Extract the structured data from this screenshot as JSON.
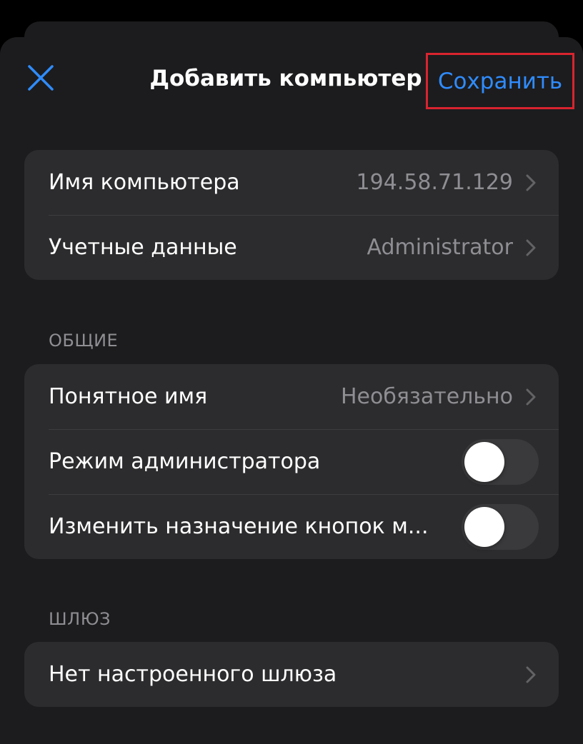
{
  "header": {
    "title": "Добавить компьютер",
    "save_label": "Сохранить",
    "close_icon": "close-icon"
  },
  "connection": {
    "rows": [
      {
        "label": "Имя компьютера",
        "value": "194.58.71.129"
      },
      {
        "label": "Учетные данные",
        "value": "Administrator"
      }
    ]
  },
  "general": {
    "header": "ОБЩИЕ",
    "friendly_name": {
      "label": "Понятное имя",
      "value": "Необязательно"
    },
    "admin_mode": {
      "label": "Режим администратора",
      "on": false
    },
    "swap_buttons": {
      "label": "Изменить назначение кнопок м...",
      "on": false
    }
  },
  "gateway": {
    "header": "ШЛЮЗ",
    "row": {
      "label": "Нет настроенного шлюза"
    }
  },
  "colors": {
    "background": "#000000",
    "sheet": "#1c1c1e",
    "cell": "#2c2c2e",
    "accent": "#2f8cff",
    "highlight_border": "#d9242f",
    "secondary_text": "#8e8e93"
  }
}
